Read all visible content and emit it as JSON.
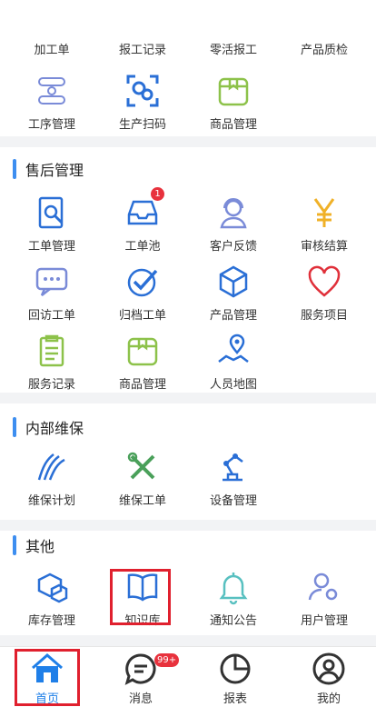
{
  "colors": {
    "accent": "#3d8ef0",
    "badge": "#e8323d",
    "highlight": "#e0202e",
    "active_tab": "#1f7fe8"
  },
  "capsule": {
    "more": "more-dots-icon",
    "minimize": "minimize-icon",
    "close": "target-close-icon"
  },
  "top_section": {
    "row0": [
      "加工单",
      "报工记录",
      "零活报工",
      "产品质检"
    ],
    "row1": [
      "工序管理",
      "生产扫码",
      "商品管理"
    ]
  },
  "after_sales": {
    "title": "售后管理",
    "items": [
      "工单管理",
      "工单池",
      "客户反馈",
      "审核结算",
      "回访工单",
      "归档工单",
      "产品管理",
      "服务项目",
      "服务记录",
      "商品管理",
      "人员地图"
    ],
    "pool_badge": "1"
  },
  "internal": {
    "title": "内部维保",
    "items": [
      "维保计划",
      "维保工单",
      "设备管理"
    ]
  },
  "other": {
    "title": "其他",
    "items": [
      "库存管理",
      "知识库",
      "通知公告",
      "用户管理"
    ]
  },
  "tabbar": {
    "items": [
      "首页",
      "消息",
      "报表",
      "我的"
    ],
    "message_badge": "99+"
  }
}
